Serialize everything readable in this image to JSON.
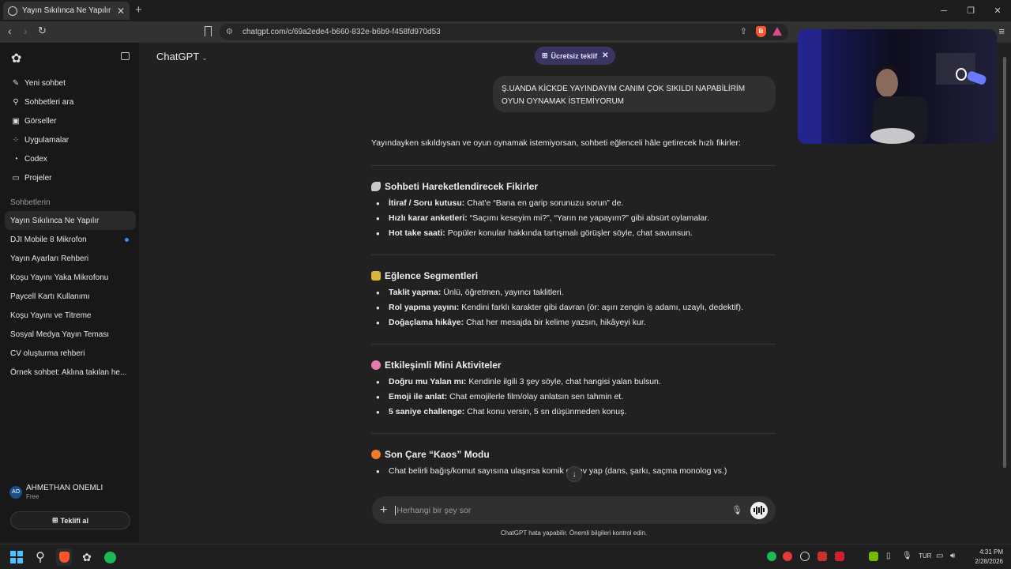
{
  "browser": {
    "tab_title": "Yayın Sıkılınca Ne Yapılır",
    "tab_close": "✕",
    "new_tab": "+",
    "url": "chatgpt.com/c/69a2ede4-b660-832e-b6b9-f458fd970d53"
  },
  "sidebar": {
    "nav": [
      {
        "label": "Yeni sohbet",
        "icon": "edit-icon"
      },
      {
        "label": "Sohbetleri ara",
        "icon": "search-icon"
      },
      {
        "label": "Görseller",
        "icon": "image-icon"
      },
      {
        "label": "Uygulamalar",
        "icon": "apps-icon"
      },
      {
        "label": "Codex",
        "icon": "codex-icon"
      },
      {
        "label": "Projeler",
        "icon": "folder-icon"
      }
    ],
    "section_title": "Sohbetlerin",
    "chats": [
      "Yayın Sıkılınca Ne Yapılır",
      "DJI Mobile 8 Mikrofon",
      "Yayın Ayarları Rehberi",
      "Koşu Yayını Yaka Mikrofonu",
      "Paycell Kartı Kullanımı",
      "Koşu Yayını ve Titreme",
      "Sosyal Medya Yayın Teması",
      "CV oluşturma rehberi",
      "Örnek sohbet: Aklına takılan he..."
    ],
    "user": {
      "initials": "AO",
      "name": "AHMETHAN ONEMLI",
      "plan": "Free"
    },
    "upgrade_label": "Teklifi al"
  },
  "header": {
    "model_label": "ChatGPT",
    "offer_label": "Ücretsiz teklif"
  },
  "conversation": {
    "user_message": "Ş.UANDA KİCKDE YAYINDAYIM CANIM ÇOK SIKILDI NAPABİLİRİM OYUN OYNAMAK İSTEMİYORUM",
    "intro": "Yayındayken sıkıldıysan ve oyun oynamak istemiyorsan, sohbeti eğlenceli hâle getirecek hızlı fikirler:",
    "sections": [
      {
        "title": "Sohbeti Hareketlendirecek Fikirler",
        "emoji_color": "#c9c9c9",
        "items": [
          {
            "bold": "İtiraf / Soru kutusu:",
            "text": "Chat'e “Bana en garip sorunuzu sorun” de."
          },
          {
            "bold": "Hızlı karar anketleri:",
            "text": "“Saçımı keseyim mi?”, “Yarın ne yapayım?” gibi absürt oylamalar."
          },
          {
            "bold": "Hot take saati:",
            "text": "Popüler konular hakkında tartışmalı görüşler söyle, chat savunsun."
          }
        ]
      },
      {
        "title": "Eğlence Segmentleri",
        "emoji_color": "#d9b23a",
        "items": [
          {
            "bold": "Taklit yapma:",
            "text": "Ünlü, öğretmen, yayıncı taklitleri."
          },
          {
            "bold": "Rol yapma yayını:",
            "text": "Kendini farklı karakter gibi davran (ör: aşırı zengin iş adamı, uzaylı, dedektif)."
          },
          {
            "bold": "Doğaçlama hikâye:",
            "text": "Chat her mesajda bir kelime yazsın, hikâyeyi kur."
          }
        ]
      },
      {
        "title": "Etkileşimli Mini Aktiviteler",
        "emoji_color": "#e87ab0",
        "items": [
          {
            "bold": "Doğru mu Yalan mı:",
            "text": "Kendinle ilgili 3 şey söyle, chat hangisi yalan bulsun."
          },
          {
            "bold": "Emoji ile anlat:",
            "text": "Chat emojilerle film/olay anlatsın sen tahmin et."
          },
          {
            "bold": "5 saniye challenge:",
            "text": "Chat konu versin, 5 sn düşünmeden konuş."
          }
        ]
      },
      {
        "title": "Son Çare “Kaos” Modu",
        "emoji_color": "#f07a2a",
        "items": [
          {
            "bold": "",
            "text": "Chat belirli bağış/komut sayısına ulaşırsa komik görev yap (dans, şarkı, saçma monolog vs.)"
          }
        ]
      }
    ]
  },
  "composer": {
    "placeholder": "Herhangi bir şey sor",
    "disclaimer": "ChatGPT hata yapabilir. Önemli bilgileri kontrol edin."
  },
  "taskbar": {
    "language": "TUR",
    "time": "4:31 PM",
    "date": "2/28/2026"
  }
}
